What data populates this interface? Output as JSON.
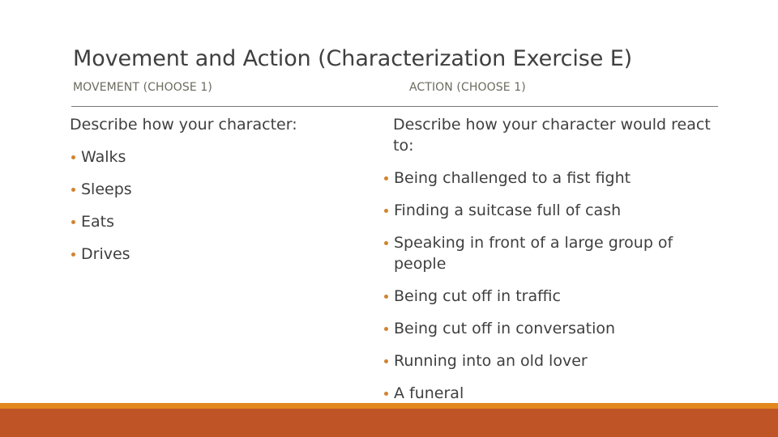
{
  "slide": {
    "title": "Movement and Action (Characterization Exercise E)",
    "columns": [
      {
        "header": "MOVEMENT (CHOOSE 1)",
        "intro": "Describe how your character:",
        "items": [
          "Walks",
          "Sleeps",
          "Eats",
          "Drives"
        ]
      },
      {
        "header": "ACTION (CHOOSE 1)",
        "intro": "Describe how your character would react to:",
        "items": [
          "Being challenged to a fist fight",
          "Finding a suitcase full of cash",
          "Speaking in front of a large group of people",
          "Being cut off in traffic",
          "Being cut off in conversation",
          "Running into an old lover",
          "A funeral"
        ]
      }
    ]
  },
  "colors": {
    "accent_strip": "#e2881e",
    "accent_band": "#bf5427",
    "bullet": "#d2832f",
    "title_text": "#3f3f3f",
    "header_text": "#6b6b5e",
    "divider": "#7a7a7a"
  }
}
